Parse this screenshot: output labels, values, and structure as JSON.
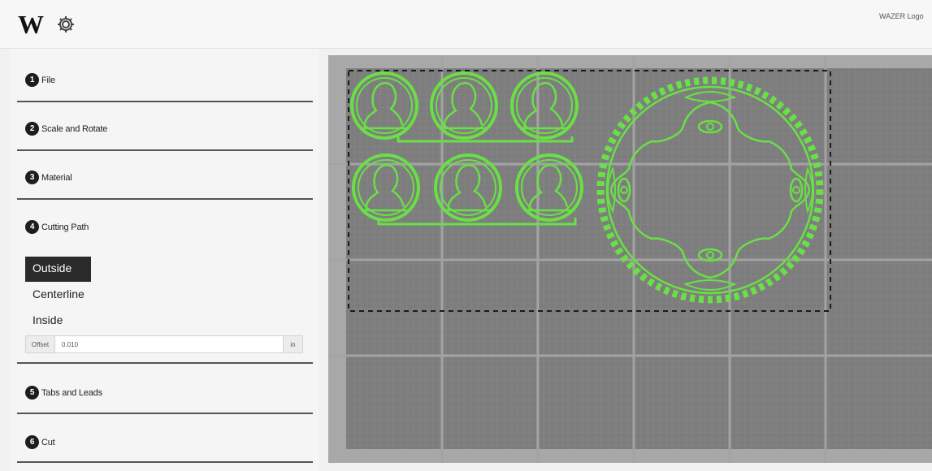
{
  "header": {
    "logo": "W",
    "settings_icon": "gear-icon",
    "user_label": "WAZER Logo"
  },
  "sidebar": {
    "sections": [
      {
        "number": "1",
        "label": "File"
      },
      {
        "number": "2",
        "label": "Scale and Rotate"
      },
      {
        "number": "3",
        "label": "Material"
      },
      {
        "number": "4",
        "label": "Cutting Path"
      },
      {
        "number": "5",
        "label": "Tabs and Leads"
      },
      {
        "number": "6",
        "label": "Cut"
      }
    ],
    "cutting_path": {
      "options": [
        "Outside",
        "Centerline",
        "Inside"
      ],
      "selected": "Outside",
      "offset_label": "Offset",
      "offset_value": "0.010",
      "offset_unit": "in"
    }
  },
  "workspace": {
    "accent_color": "#69e046",
    "grid_color": "#8a8a8a",
    "stock_color": "#7d7d7d",
    "parts": [
      "portrait-medallion",
      "portrait-medallion",
      "portrait-medallion",
      "portrait-medallion",
      "portrait-medallion",
      "portrait-medallion",
      "chainring-gear"
    ]
  }
}
